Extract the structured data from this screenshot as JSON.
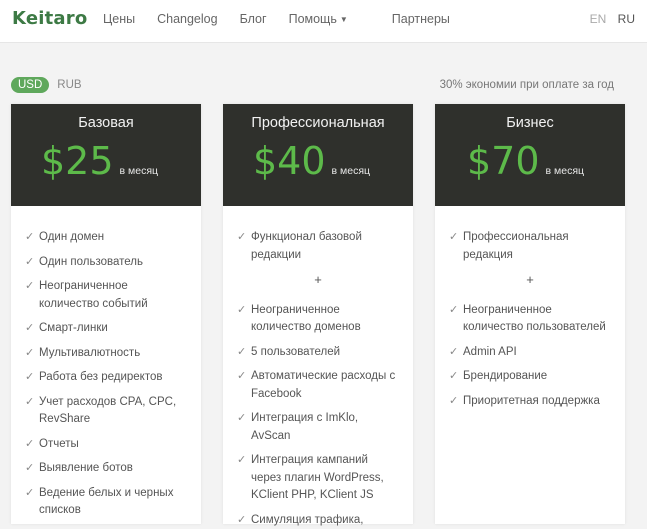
{
  "header": {
    "logo": "Keitaro",
    "nav": [
      "Цены",
      "Changelog",
      "Блог",
      "Помощь",
      "Партнеры"
    ],
    "languages": [
      "EN",
      "RU"
    ]
  },
  "pricing": {
    "currencies": [
      "USD",
      "RUB"
    ],
    "savings": "30% экономии при оплате за год"
  },
  "plans": [
    {
      "name": "Базовая",
      "price": "$25",
      "period": "в месяц",
      "features": [
        "Один домен",
        "Один пользователь",
        "Неограниченное количество событий",
        "Смарт-линки",
        "Мультивалютность",
        "Работа без редиректов",
        "Учет расходов CPA, CPC, RevShare",
        "Отчеты",
        "Выявление ботов",
        "Ведение белых и черных списков"
      ]
    },
    {
      "name": "Профессиональная",
      "price": "$40",
      "period": "в месяц",
      "base": "Функционал базовой редакции",
      "plus": "+",
      "features": [
        "Неограниченное количество доменов",
        "5 пользователей",
        "Автоматические расходы с Facebook",
        "Интеграция с ImKlo, AvScan",
        "Интеграция кампаний через плагин WordPress, KClient PHP, KClient JS",
        "Симуляция трафика,"
      ]
    },
    {
      "name": "Бизнес",
      "price": "$70",
      "period": "в месяц",
      "base": "Профессиональная редакция",
      "plus": "+",
      "features": [
        "Неограниченное количество пользователей",
        "Admin API",
        "Брендирование",
        "Приоритетная поддержка"
      ]
    }
  ],
  "colors": {
    "brand": "#3d7a45",
    "price": "#5dba4a",
    "card_header": "#2f302c",
    "currency_active": "#5fa85c"
  }
}
